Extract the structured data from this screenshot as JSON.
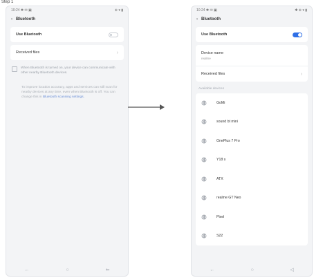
{
  "step_label": "Step 1",
  "left": {
    "status": {
      "left": "10:24 ✱ ✉ ▣",
      "right": "⊕ ▾ ▮"
    },
    "header": {
      "back": "‹",
      "title": "Bluetooth"
    },
    "use_bluetooth_label": "Use Bluetooth",
    "use_bluetooth_on": false,
    "received_files_label": "Received files",
    "info_text": "When Bluetooth is turned on, your device can communicate with other nearby Bluetooth devices.",
    "info2_text": "To improve location accuracy, apps and services can still scan for nearby devices at any time, even when Bluetooth is off. You can change this in",
    "info2_link": "Bluetooth scanning settings.",
    "nav": [
      "←",
      "○",
      "⇐"
    ]
  },
  "right": {
    "status": {
      "left": "10:24 ✱ ✉ ▣",
      "right": "✱ ⊕ ▾ ▮"
    },
    "header": {
      "back": "‹",
      "title": "Bluetooth"
    },
    "use_bluetooth_label": "Use Bluetooth",
    "use_bluetooth_on": true,
    "device_name_label": "Device name",
    "device_name_value": "realme",
    "received_files_label": "Received files",
    "available_label": "Available devices",
    "devices": [
      "GoMi",
      "sound bt mini",
      "OnePlus 7 Pro",
      "Y18 s",
      "ATX",
      "realme GT Neo",
      "Pixel",
      "S22"
    ],
    "nav": [
      "←",
      "○",
      "◁"
    ]
  }
}
